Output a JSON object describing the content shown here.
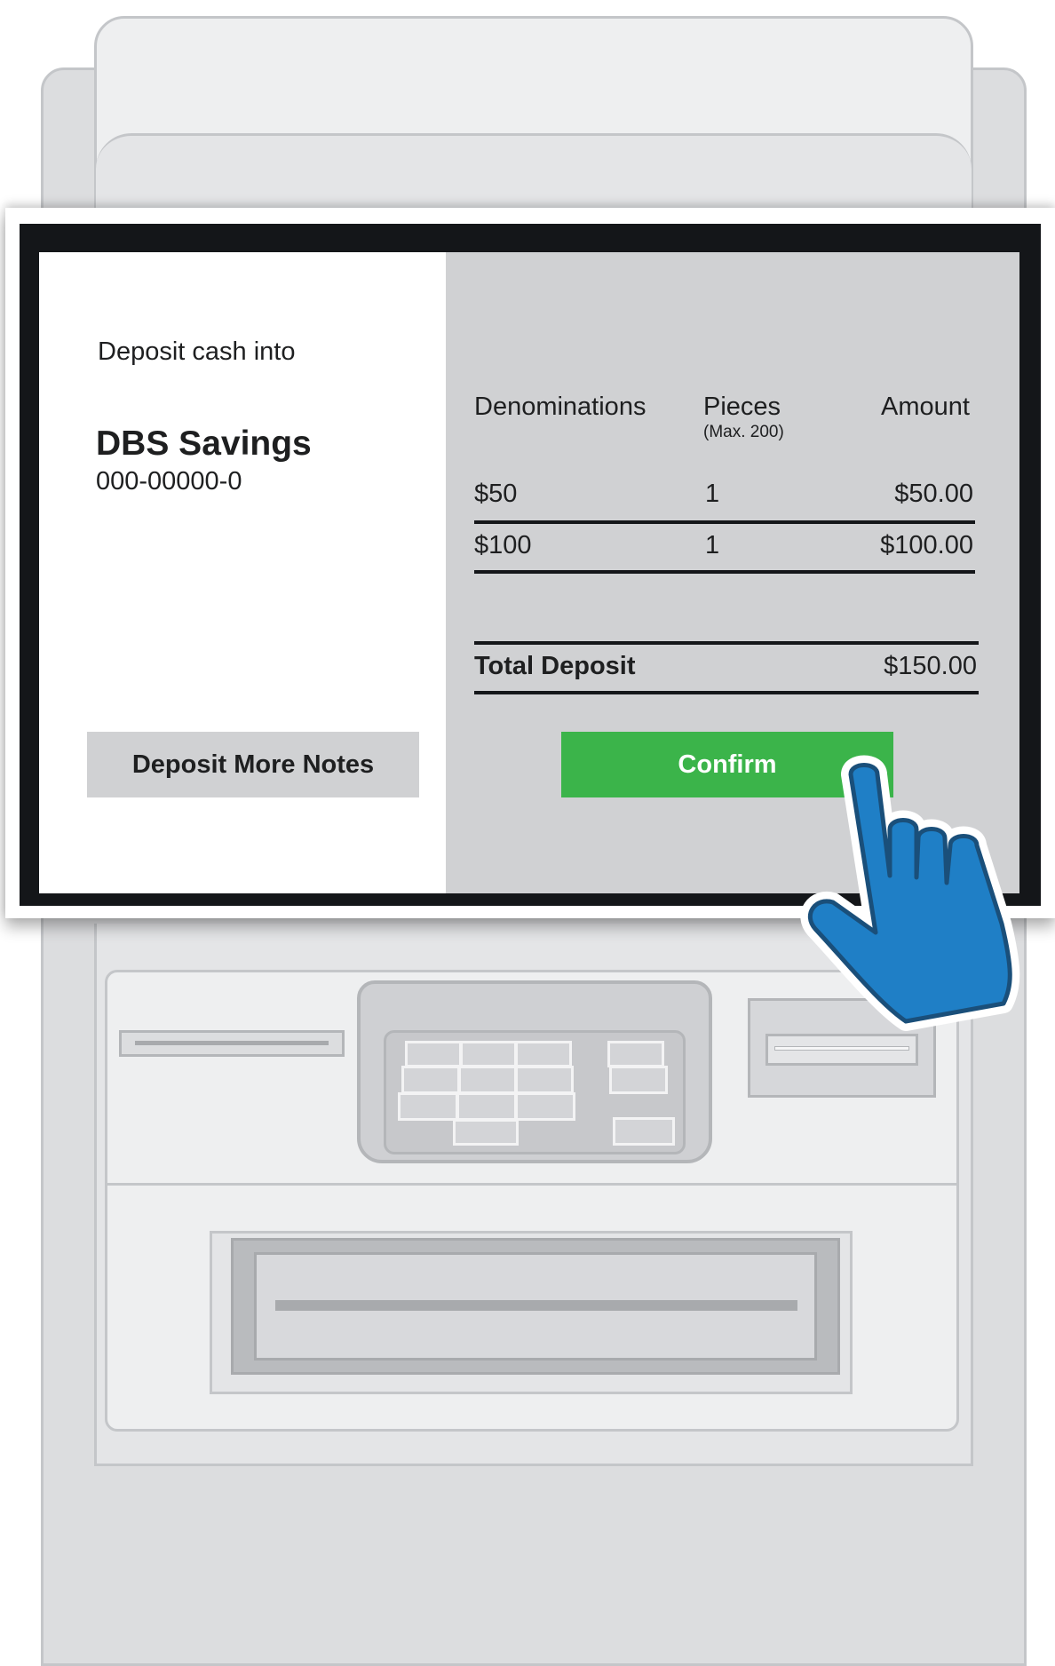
{
  "screen": {
    "left_panel": {
      "heading": "Deposit cash into",
      "account_name": "DBS Savings",
      "account_number": "000-00000-0",
      "deposit_more_label": "Deposit More Notes"
    },
    "table": {
      "headers": {
        "denominations": "Denominations",
        "pieces": "Pieces",
        "pieces_note": "(Max. 200)",
        "amount": "Amount"
      },
      "rows": [
        {
          "denomination": "$50",
          "pieces": "1",
          "amount": "$50.00"
        },
        {
          "denomination": "$100",
          "pieces": "1",
          "amount": "$100.00"
        }
      ],
      "total_label": "Total Deposit",
      "total_amount": "$150.00"
    },
    "confirm_label": "Confirm"
  },
  "icons": {
    "pointer": "pointing-hand-icon"
  },
  "colors": {
    "confirm": "#3bb44a",
    "secondary_button": "#d0d1d3",
    "bezel": "#141619",
    "hand": "#1f7fc6"
  }
}
